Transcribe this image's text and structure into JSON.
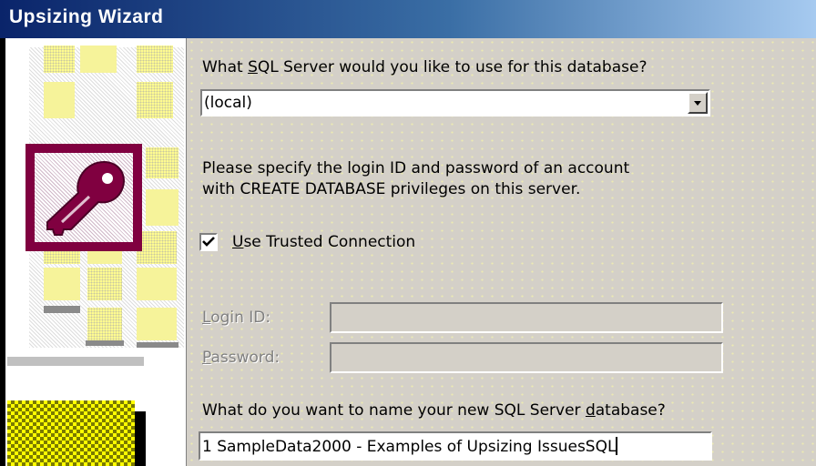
{
  "window": {
    "title": "Upsizing Wizard"
  },
  "server": {
    "prompt_pre": "What ",
    "prompt_key": "S",
    "prompt_post": "QL Server would you like to use for this database?",
    "selected": "(local)"
  },
  "login_info": {
    "line1": "Please specify the login ID and password of an account",
    "line2": "with CREATE DATABASE privileges on this server."
  },
  "trusted": {
    "checked": true,
    "label_key": "U",
    "label_rest": "se Trusted Connection"
  },
  "login": {
    "label_key": "L",
    "label_rest": "ogin ID:",
    "value": ""
  },
  "password": {
    "label_key": "P",
    "label_rest": "assword:",
    "value": ""
  },
  "database": {
    "prompt_pre": "What do you want to name your new SQL Server ",
    "prompt_key": "d",
    "prompt_post": "atabase?",
    "value": "1 SampleData2000 - Examples of Upsizing IssuesSQL"
  },
  "icons": {
    "logo": "access-key-icon",
    "dropdown": "chevron-down-icon",
    "checkmark": "checkmark-icon",
    "database": "database-cylinder-icon"
  },
  "colors": {
    "titlebar_start": "#0a246a",
    "titlebar_end": "#a6caf0",
    "logo_frame": "#800040",
    "face": "#d4d0c8"
  }
}
